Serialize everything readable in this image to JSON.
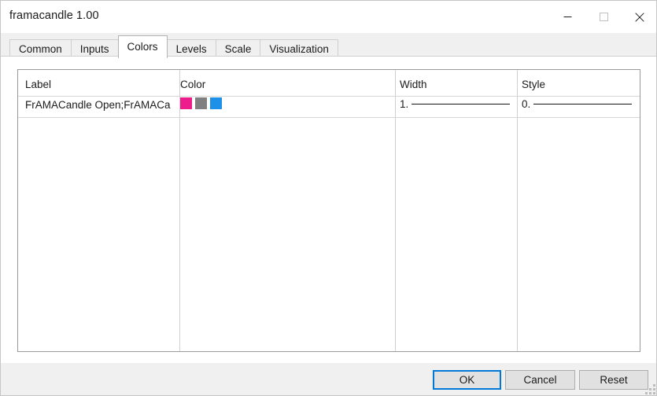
{
  "window": {
    "title": "framacandle 1.00",
    "controls": [
      {
        "name": "minimize",
        "glyph": "minimize-icon",
        "enabled": true
      },
      {
        "name": "maximize",
        "glyph": "maximize-icon",
        "enabled": false
      },
      {
        "name": "close",
        "glyph": "close-icon",
        "enabled": true
      }
    ]
  },
  "tabs": {
    "items": [
      {
        "label": "Common",
        "active": false
      },
      {
        "label": "Inputs",
        "active": false
      },
      {
        "label": "Colors",
        "active": true
      },
      {
        "label": "Levels",
        "active": false
      },
      {
        "label": "Scale",
        "active": false
      },
      {
        "label": "Visualization",
        "active": false
      }
    ],
    "active": "Colors"
  },
  "grid": {
    "columns": [
      {
        "key": "label",
        "header": "Label"
      },
      {
        "key": "color",
        "header": "Color"
      },
      {
        "key": "width",
        "header": "Width"
      },
      {
        "key": "style",
        "header": "Style"
      }
    ],
    "rows": [
      {
        "label": "FrAMACandle Open;FrAMACan...",
        "colors": [
          "#ec1c8c",
          "#808080",
          "#1e90e8"
        ],
        "width_value": "1.",
        "width_line": "solid",
        "style_value": "0.",
        "style_line": "solid"
      }
    ]
  },
  "footer": {
    "buttons": [
      {
        "label": "OK",
        "default": true
      },
      {
        "label": "Cancel",
        "default": false
      },
      {
        "label": "Reset",
        "default": false
      }
    ],
    "resize_grip": "resize-grip-icon"
  },
  "colors": {
    "accent": "#0078d7",
    "window_bg": "#f0f0f0",
    "panel_bg": "#ffffff",
    "text": "#1b1b1b",
    "border": "#9a9a9a"
  }
}
